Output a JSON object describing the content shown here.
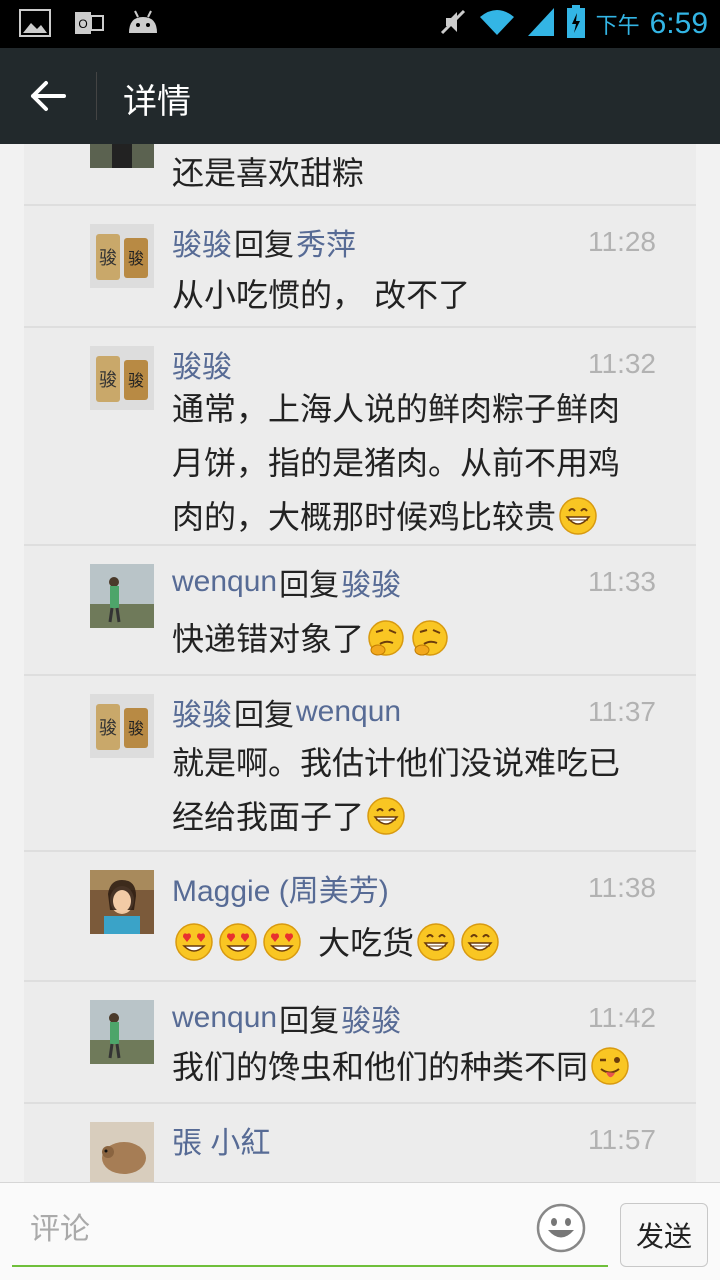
{
  "status_bar": {
    "ampm": "下午",
    "time": "6:59"
  },
  "action_bar": {
    "title": "详情"
  },
  "comments": [
    {
      "name": "",
      "reply_word": "",
      "reply_to": "",
      "time": "",
      "text": "还是喜欢甜粽"
    },
    {
      "name": "骏骏",
      "reply_word": "回复",
      "reply_to": "秀萍",
      "time": "11:28",
      "text": "从小吃惯的， 改不了"
    },
    {
      "name": "骏骏",
      "reply_word": "",
      "reply_to": "",
      "time": "11:32",
      "text_lines": [
        "通常，上海人说的鲜肉粽子鲜肉",
        "月饼，指的是猪肉。从前不用鸡",
        "肉的，大概那时候鸡比较贵"
      ],
      "emoji": "grin-emoji"
    },
    {
      "name": "wenqun",
      "reply_word": "回复",
      "reply_to": "骏骏",
      "time": "11:33",
      "text": "快递错对象了",
      "emoji": "thinking-emoji"
    },
    {
      "name": "骏骏",
      "reply_word": "回复",
      "reply_to": "wenqun",
      "time": "11:37",
      "text_lines": [
        "就是啊。我估计他们没说难吃已",
        "经给我面子了"
      ],
      "emoji": "grin-emoji"
    },
    {
      "name": "Maggie (周美芳)",
      "reply_word": "",
      "reply_to": "",
      "time": "11:38",
      "text": "大吃货",
      "emoji": "heart-eyes-emoji"
    },
    {
      "name": "wenqun",
      "reply_word": "回复",
      "reply_to": "骏骏",
      "time": "11:42",
      "text": "我们的馋虫和他们的种类不同",
      "emoji": "wink-tongue-emoji"
    },
    {
      "name": "張 小紅",
      "reply_word": "",
      "reply_to": "",
      "time": "11:57",
      "text": ""
    }
  ],
  "input_bar": {
    "placeholder": "评论",
    "send_label": "发送"
  },
  "colors": {
    "name": "#576b95",
    "time": "#b2b2b2",
    "actionbar": "#22292c",
    "accent_underline": "#6fbf3a"
  }
}
